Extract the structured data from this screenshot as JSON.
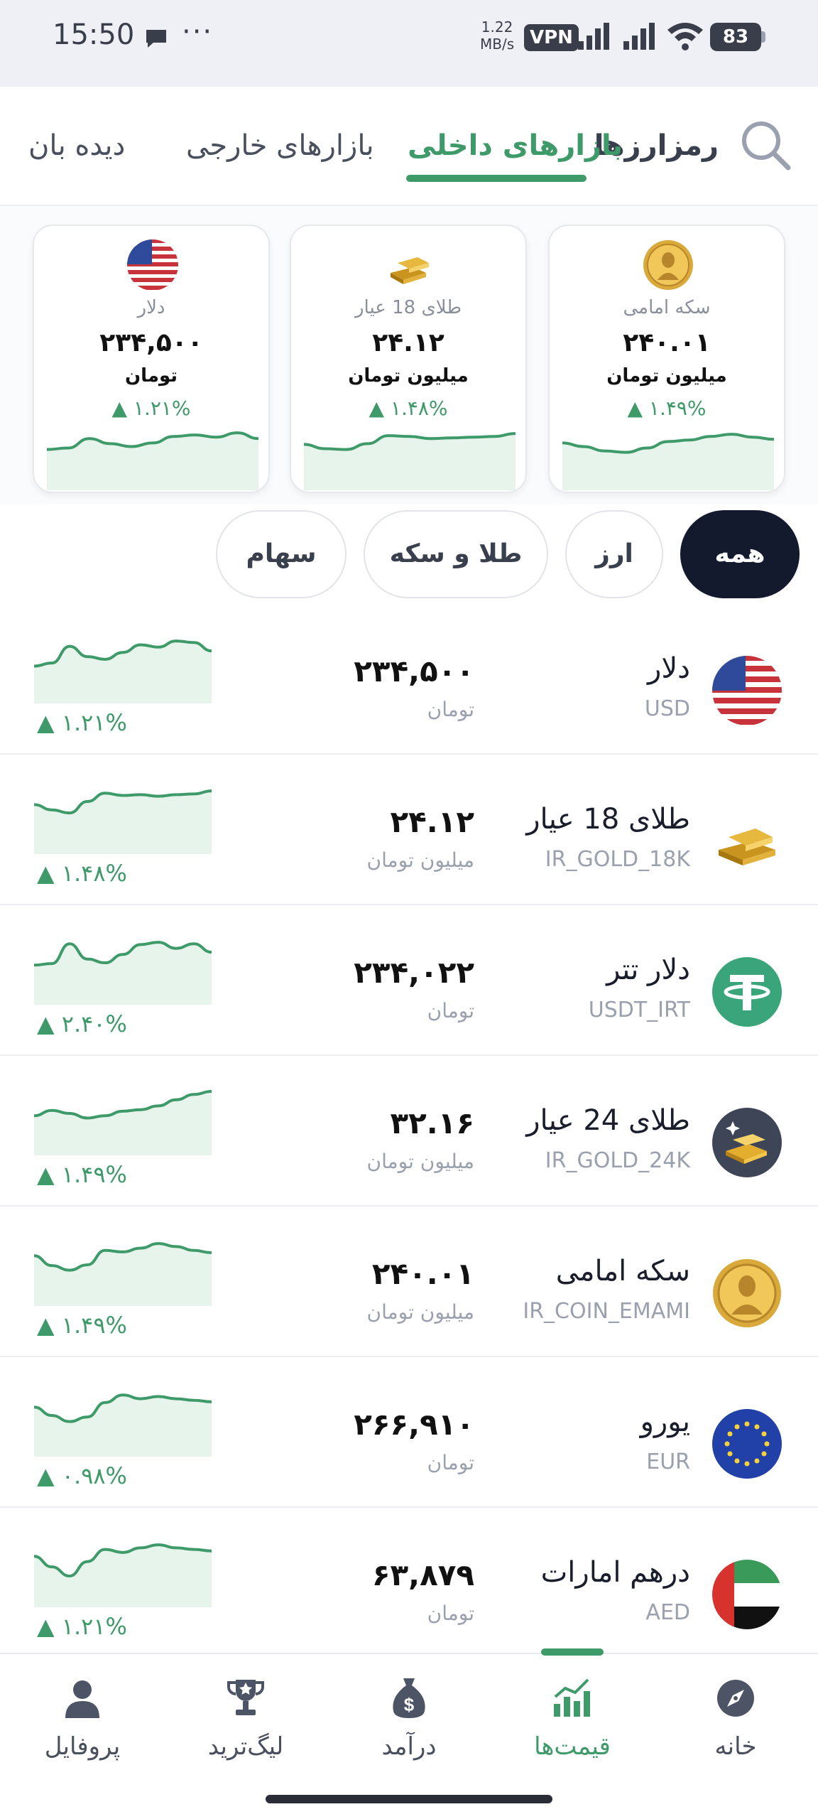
{
  "status": {
    "time": "15:50",
    "speed_value": "1.22",
    "speed_unit": "MB/s",
    "vpn": "VPN",
    "battery": "83"
  },
  "topnav": {
    "tabs": [
      {
        "label": "رمزارزها"
      },
      {
        "label": "بازارهای داخلی"
      },
      {
        "label": "بازارهای خارجی"
      },
      {
        "label": "دیده بان"
      }
    ],
    "active": "بازارهای داخلی"
  },
  "cards": [
    {
      "name": "سکه امامی",
      "price": "۲۴۰.۰۱",
      "unit": "میلیون تومان",
      "change": "▲ ۱.۴۹%",
      "icon": "gold-coin-icon",
      "series": [
        0.62,
        0.52,
        0.4,
        0.36,
        0.48,
        0.66,
        0.7,
        0.8,
        0.86,
        0.78,
        0.72
      ]
    },
    {
      "name": "طلای 18 عیار",
      "price": "۲۴.۱۲",
      "unit": "میلیون تومان",
      "change": "▲ ۱.۴۸%",
      "icon": "gold-bars-icon",
      "series": [
        0.58,
        0.46,
        0.44,
        0.6,
        0.82,
        0.8,
        0.74,
        0.76,
        0.78,
        0.8,
        0.88
      ]
    },
    {
      "name": "دلار",
      "price": "۲۳۴,۵۰۰",
      "unit": "تومان",
      "change": "▲ ۱.۲۱%",
      "icon": "us-flag-icon",
      "series": [
        0.44,
        0.48,
        0.74,
        0.6,
        0.52,
        0.62,
        0.8,
        0.84,
        0.78,
        0.9,
        0.74
      ]
    }
  ],
  "filters": [
    {
      "label": "همه",
      "active": true
    },
    {
      "label": "ارز"
    },
    {
      "label": "طلا و سکه"
    },
    {
      "label": "سهام"
    }
  ],
  "assets": [
    {
      "name": "دلار",
      "symbol": "USD",
      "price": "۲۳۴,۵۰۰",
      "unit": "تومان",
      "change": "▲ ۱.۲۱%",
      "icon": "us-flag-icon",
      "series": [
        0.3,
        0.38,
        0.82,
        0.55,
        0.48,
        0.66,
        0.86,
        0.8,
        0.96,
        0.92,
        0.7
      ]
    },
    {
      "name": "طلای 18 عیار",
      "symbol": "IR_GOLD_18K",
      "price": "۲۴.۱۲",
      "unit": "میلیون تومان",
      "change": "▲ ۱.۴۸%",
      "icon": "gold-bars-icon",
      "series": [
        0.62,
        0.48,
        0.4,
        0.7,
        0.92,
        0.86,
        0.88,
        0.84,
        0.88,
        0.9,
        0.98
      ]
    },
    {
      "name": "دلار تتر",
      "symbol": "USDT_IRT",
      "price": "۲۳۴,۰۲۲",
      "unit": "تومان",
      "change": "▲ ۲.۴۰%",
      "icon": "tether-icon",
      "series": [
        0.36,
        0.4,
        0.92,
        0.52,
        0.42,
        0.64,
        0.9,
        0.96,
        0.8,
        0.92,
        0.7
      ]
    },
    {
      "name": "طلای 24 عیار",
      "symbol": "IR_GOLD_24K",
      "price": "۳۲.۱۶",
      "unit": "میلیون تومان",
      "change": "▲ ۱.۴۹%",
      "icon": "gold-sparkle-icon",
      "series": [
        0.36,
        0.5,
        0.42,
        0.3,
        0.36,
        0.48,
        0.52,
        0.62,
        0.78,
        0.92,
        1.0
      ]
    },
    {
      "name": "سکه امامی",
      "symbol": "IR_COIN_EMAMI",
      "price": "۲۴۰.۰۱",
      "unit": "میلیون تومان",
      "change": "▲ ۱.۴۹%",
      "icon": "gold-coin-icon",
      "series": [
        0.64,
        0.38,
        0.26,
        0.4,
        0.78,
        0.74,
        0.84,
        0.96,
        0.88,
        0.78,
        0.72
      ]
    },
    {
      "name": "یورو",
      "symbol": "EUR",
      "price": "۲۶۶,۹۱۰",
      "unit": "تومان",
      "change": "▲ ۰.۹۸%",
      "icon": "eu-flag-icon",
      "series": [
        0.62,
        0.4,
        0.24,
        0.36,
        0.74,
        0.94,
        0.84,
        0.9,
        0.84,
        0.8,
        0.76
      ]
    },
    {
      "name": "درهم امارات",
      "symbol": "AED",
      "price": "۶۳,۸۷۹",
      "unit": "تومان",
      "change": "▲ ۱.۲۱%",
      "icon": "uae-flag-icon",
      "series": [
        0.66,
        0.38,
        0.14,
        0.52,
        0.84,
        0.76,
        0.88,
        0.96,
        0.88,
        0.84,
        0.8
      ]
    }
  ],
  "bottomnav": [
    {
      "label": "پروفایل",
      "icon": "user-icon"
    },
    {
      "label": "لیگ‌ترید",
      "icon": "trophy-icon"
    },
    {
      "label": "درآمد",
      "icon": "money-bag-icon"
    },
    {
      "label": "قیمت‌ها",
      "icon": "bar-chart-icon",
      "active": true
    },
    {
      "label": "خانه",
      "icon": "compass-icon"
    }
  ],
  "colors": {
    "accent": "#3f9a6a",
    "dark": "#141a2e",
    "fill": "#e6f4ec"
  }
}
